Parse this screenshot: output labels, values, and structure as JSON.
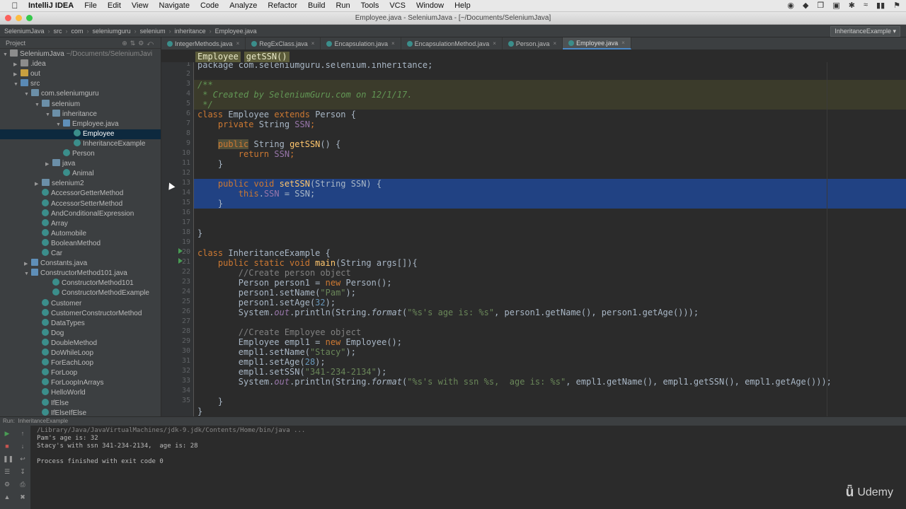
{
  "menubar": {
    "app": "IntelliJ IDEA",
    "items": [
      "File",
      "Edit",
      "View",
      "Navigate",
      "Code",
      "Analyze",
      "Refactor",
      "Build",
      "Run",
      "Tools",
      "VCS",
      "Window",
      "Help"
    ]
  },
  "window": {
    "title": "Employee.java - SeleniumJava - [~/Documents/SeleniumJava]"
  },
  "nav": {
    "crumbs": [
      "SeleniumJava",
      "src",
      "com",
      "seleniumguru",
      "selenium",
      "inheritance",
      "Employee.java"
    ],
    "run_config": "InheritanceExample"
  },
  "project": {
    "header": "Project",
    "tree": [
      {
        "label": "SeleniumJava",
        "suffix": " ~/Documents/SeleniumJavi",
        "indent": 0,
        "arrow": "down",
        "icon": "folder"
      },
      {
        "label": ".idea",
        "indent": 1,
        "arrow": "right",
        "icon": "folder"
      },
      {
        "label": "out",
        "indent": 1,
        "arrow": "right",
        "icon": "folder-y"
      },
      {
        "label": "src",
        "indent": 1,
        "arrow": "down",
        "icon": "src"
      },
      {
        "label": "com.seleniumguru",
        "indent": 2,
        "arrow": "down",
        "icon": "pkg"
      },
      {
        "label": "selenium",
        "indent": 3,
        "arrow": "down",
        "icon": "pkg"
      },
      {
        "label": "inheritance",
        "indent": 4,
        "arrow": "down",
        "icon": "pkg"
      },
      {
        "label": "Employee.java",
        "indent": 5,
        "arrow": "down",
        "icon": "file"
      },
      {
        "label": "Employee",
        "indent": 6,
        "arrow": "",
        "icon": "class",
        "selected": true
      },
      {
        "label": "InheritanceExample",
        "indent": 6,
        "arrow": "",
        "icon": "class"
      },
      {
        "label": "Person",
        "indent": 5,
        "arrow": "",
        "icon": "class"
      },
      {
        "label": "java",
        "indent": 4,
        "arrow": "right",
        "icon": "pkg"
      },
      {
        "label": "Animal",
        "indent": 5,
        "arrow": "",
        "icon": "class"
      },
      {
        "label": "selenium2",
        "indent": 3,
        "arrow": "right",
        "icon": "pkg"
      },
      {
        "label": "AccessorGetterMethod",
        "indent": 3,
        "arrow": "",
        "icon": "class"
      },
      {
        "label": "AccessorSetterMethod",
        "indent": 3,
        "arrow": "",
        "icon": "class"
      },
      {
        "label": "AndConditionalExpression",
        "indent": 3,
        "arrow": "",
        "icon": "class"
      },
      {
        "label": "Array",
        "indent": 3,
        "arrow": "",
        "icon": "class"
      },
      {
        "label": "Automobile",
        "indent": 3,
        "arrow": "",
        "icon": "class"
      },
      {
        "label": "BooleanMethod",
        "indent": 3,
        "arrow": "",
        "icon": "class"
      },
      {
        "label": "Car",
        "indent": 3,
        "arrow": "",
        "icon": "class"
      },
      {
        "label": "Constants.java",
        "indent": 2,
        "arrow": "right",
        "icon": "file"
      },
      {
        "label": "ConstructorMethod101.java",
        "indent": 2,
        "arrow": "down",
        "icon": "file"
      },
      {
        "label": "ConstructorMethod101",
        "indent": 4,
        "arrow": "",
        "icon": "class"
      },
      {
        "label": "ConstructorMethodExample",
        "indent": 4,
        "arrow": "",
        "icon": "class"
      },
      {
        "label": "Customer",
        "indent": 3,
        "arrow": "",
        "icon": "class"
      },
      {
        "label": "CustomerConstructorMethod",
        "indent": 3,
        "arrow": "",
        "icon": "class"
      },
      {
        "label": "DataTypes",
        "indent": 3,
        "arrow": "",
        "icon": "class"
      },
      {
        "label": "Dog",
        "indent": 3,
        "arrow": "",
        "icon": "class"
      },
      {
        "label": "DoubleMethod",
        "indent": 3,
        "arrow": "",
        "icon": "class"
      },
      {
        "label": "DoWhileLoop",
        "indent": 3,
        "arrow": "",
        "icon": "class"
      },
      {
        "label": "ForEachLoop",
        "indent": 3,
        "arrow": "",
        "icon": "class"
      },
      {
        "label": "ForLoop",
        "indent": 3,
        "arrow": "",
        "icon": "class"
      },
      {
        "label": "ForLoopInArrays",
        "indent": 3,
        "arrow": "",
        "icon": "class"
      },
      {
        "label": "HelloWorld",
        "indent": 3,
        "arrow": "",
        "icon": "class"
      },
      {
        "label": "IfElse",
        "indent": 3,
        "arrow": "",
        "icon": "class"
      },
      {
        "label": "IfElseIfElse",
        "indent": 3,
        "arrow": "",
        "icon": "class"
      }
    ]
  },
  "tabs": [
    {
      "label": "IntegerMethods.java",
      "active": false
    },
    {
      "label": "RegExClass.java",
      "active": false
    },
    {
      "label": "Encapsulation.java",
      "active": false
    },
    {
      "label": "EncapsulationMethod.java",
      "active": false
    },
    {
      "label": "Person.java",
      "active": false
    },
    {
      "label": "Employee.java",
      "active": true
    }
  ],
  "editor": {
    "crumbs": [
      "Employee",
      "getSSN()"
    ],
    "line_numbers": [
      "1",
      "2",
      "3",
      "4",
      "5",
      "6",
      "7",
      "8",
      "9",
      "10",
      "11",
      "12",
      "13",
      "14",
      "15",
      "16",
      "17",
      "18",
      "19",
      "20",
      "21",
      "22",
      "23",
      "24",
      "25",
      "26",
      "27",
      "28",
      "29",
      "30",
      "31",
      "32",
      "33",
      "34",
      "35"
    ],
    "code": {
      "l1": "package com.seleniumguru.selenium.inheritance;",
      "l3": "/**",
      "l4": " * Created by SeleniumGuru.com on 12/1/17.",
      "l5": " */",
      "l6_k": "class ",
      "l6_a": "Employee ",
      "l6_k2": "extends ",
      "l6_b": "Person {",
      "l7_k": "    private ",
      "l7_a": "String ",
      "l7_f": "SSN",
      "l7_b": ";",
      "l9_k": "public",
      "l9_a": " String ",
      "l9_m": "getSSN",
      "l9_b": "() {",
      "l10_k": "        return ",
      "l10_f": "SSN",
      "l10_b": ";",
      "l11": "    }",
      "l13_k": "    public void ",
      "l13_m": "setSSN",
      "l13_b": "(String SSN) {",
      "l14_k": "        this",
      "l14_a": ".",
      "l14_f": "SSN",
      "l14_b": " = SSN;",
      "l15": "    }",
      "l18": "}",
      "l20_k": "class ",
      "l20_a": "InheritanceExample {",
      "l21_k": "    public static void ",
      "l21_m": "main",
      "l21_b": "(String args[]){",
      "l22": "        //Create person object",
      "l23_a": "        Person person1 = ",
      "l23_k": "new ",
      "l23_b": "Person();",
      "l24_a": "        person1.setName(",
      "l24_s": "\"Pam\"",
      "l24_b": ");",
      "l25_a": "        person1.setAge(",
      "l25_n": "32",
      "l25_b": ");",
      "l26_a": "        System.",
      "l26_f": "out",
      "l26_b": ".println(String.",
      "l26_i": "format",
      "l26_c": "(",
      "l26_s": "\"%s's age is: %s\"",
      "l26_d": ", person1.getName(), person1.getAge()));",
      "l28": "        //Create Employee object",
      "l29_a": "        Employee empl1 = ",
      "l29_k": "new ",
      "l29_b": "Employee();",
      "l30_a": "        empl1.setName(",
      "l30_s": "\"Stacy\"",
      "l30_b": ");",
      "l31_a": "        empl1.setAge(",
      "l31_n": "28",
      "l31_b": ");",
      "l32_a": "        empl1.setSSN(",
      "l32_s": "\"341-234-2134\"",
      "l32_b": ");",
      "l33_a": "        System.",
      "l33_f": "out",
      "l33_b": ".println(String.",
      "l33_i": "format",
      "l33_c": "(",
      "l33_s": "\"%s's with ssn %s,  age is: %s\"",
      "l33_d": ", empl1.getName(), empl1.getSSN(), empl1.getAge()));",
      "l34": "    }",
      "l35": "}"
    }
  },
  "run": {
    "header_label": "Run",
    "config": "InheritanceExample",
    "console": [
      "/Library/Java/JavaVirtualMachines/jdk-9.jdk/Contents/Home/bin/java ...",
      "Pam's age is: 32",
      "Stacy's with ssn 341-234-2134,  age is: 28",
      "",
      "Process finished with exit code 0"
    ]
  },
  "watermark": {
    "brand": "Udemy"
  }
}
